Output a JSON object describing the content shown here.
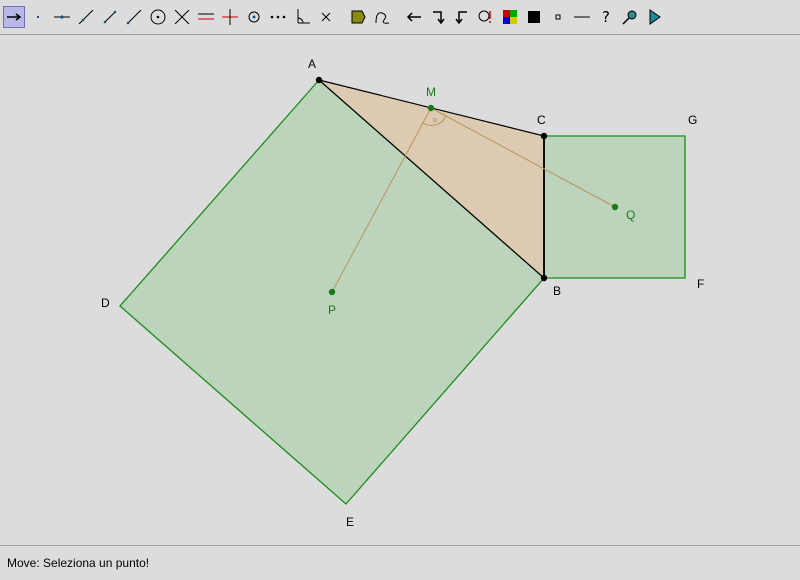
{
  "toolbar": {
    "tools": [
      {
        "name": "move-tool",
        "glyph": "⟶",
        "selected": true
      },
      {
        "name": "point-tool",
        "glyph": "·"
      },
      {
        "name": "point-on-object-tool",
        "glyph": "–"
      },
      {
        "name": "line-tool",
        "glyph": "⁄"
      },
      {
        "name": "segment-tool",
        "glyph": "⁄"
      },
      {
        "name": "ray-tool",
        "glyph": "⁄"
      },
      {
        "name": "circle-tool",
        "glyph": "⊙"
      },
      {
        "name": "intersect-tool",
        "glyph": "✕"
      },
      {
        "name": "parallel-tool",
        "glyph": "="
      },
      {
        "name": "perpendicular-tool",
        "glyph": "+"
      },
      {
        "name": "midpoint-tool",
        "glyph": "⊙"
      },
      {
        "name": "dotted-tool",
        "glyph": "⋯"
      },
      {
        "name": "angle-tool",
        "glyph": "∠"
      },
      {
        "name": "delete-tool",
        "glyph": "×"
      },
      {
        "name": "polygon-tool",
        "glyph": "⬟"
      },
      {
        "name": "locus-tool",
        "glyph": "ℓ"
      },
      {
        "name": "undo-tool",
        "glyph": "←"
      },
      {
        "name": "redo-tool",
        "glyph": "↱"
      },
      {
        "name": "macro-tool",
        "glyph": "↰"
      },
      {
        "name": "zoom-tool",
        "glyph": "⊘"
      },
      {
        "name": "color-tool",
        "glyph": "▦"
      },
      {
        "name": "fill-tool",
        "glyph": "■"
      },
      {
        "name": "point-style-tool",
        "glyph": "▫"
      },
      {
        "name": "line-style-tool",
        "glyph": "—"
      },
      {
        "name": "help-tool",
        "glyph": "?"
      },
      {
        "name": "trace-tool",
        "glyph": "⚲"
      },
      {
        "name": "animate-tool",
        "glyph": "▶"
      }
    ]
  },
  "colors": {
    "square_fill": "#bcd4bc",
    "square_stroke": "#1a8c1a",
    "triangle_fill": "#dcc8aa",
    "median_line": "#b8965a",
    "green_label": "#1a7a1a"
  },
  "points": {
    "A": "A",
    "B": "B",
    "C": "C",
    "D": "D",
    "E": "E",
    "F": "F",
    "G": "G",
    "M": "M",
    "P": "P",
    "Q": "Q"
  },
  "status": {
    "text": "Move: Seleziona un punto!"
  }
}
